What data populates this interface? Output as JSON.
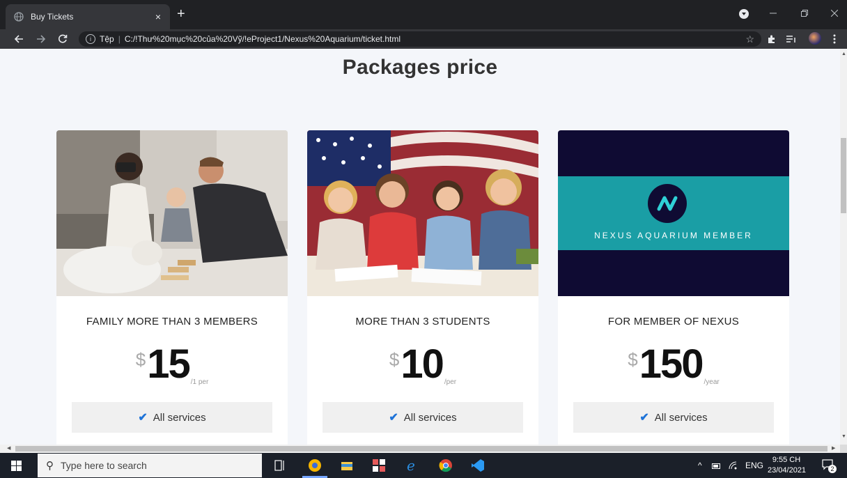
{
  "browser": {
    "tab_title": "Buy Tickets",
    "tab_close": "×",
    "new_tab": "+",
    "address_scheme": "Tệp",
    "address_url": "C:/!Thư%20mục%20của%20Vỹ/!eProject1/Nexus%20Aquarium/ticket.html"
  },
  "page": {
    "section_title": "Packages price",
    "packages": [
      {
        "name": "FAMILY MORE THAN 3 MEMBERS",
        "currency": "$",
        "amount": "15",
        "unit": "/1 per",
        "service": "All services"
      },
      {
        "name": "MORE THAN 3 STUDENTS",
        "currency": "$",
        "amount": "10",
        "unit": "/per",
        "service": "All services"
      },
      {
        "name": "FOR MEMBER OF NEXUS",
        "currency": "$",
        "amount": "150",
        "unit": "/year",
        "service": "All services",
        "banner_text": "NEXUS AQUARIUM MEMBER"
      }
    ]
  },
  "taskbar": {
    "search_placeholder": "Type here to search",
    "language": "ENG",
    "time": "9:55 CH",
    "date": "23/04/2021",
    "notification_count": "2"
  },
  "colors": {
    "chrome_dark": "#202124",
    "chrome_toolbar": "#35363a",
    "page_bg": "#f4f6fa",
    "check_blue": "#1e73d8",
    "nexus_navy": "#0f0b33",
    "nexus_teal": "#1a9ea5",
    "taskbar": "#1b2029"
  },
  "icons": [
    "globe-icon",
    "close-icon",
    "plus-icon",
    "back-arrow-icon",
    "forward-arrow-icon",
    "reload-icon",
    "info-icon",
    "star-icon",
    "extensions-puzzle-icon",
    "reading-list-icon",
    "menu-dots-icon",
    "check-icon",
    "windows-logo-icon",
    "search-icon",
    "task-view-icon",
    "chrome-icon",
    "file-explorer-icon",
    "edge-icon",
    "vscode-icon",
    "network-icon",
    "wifi-icon",
    "notification-icon"
  ]
}
